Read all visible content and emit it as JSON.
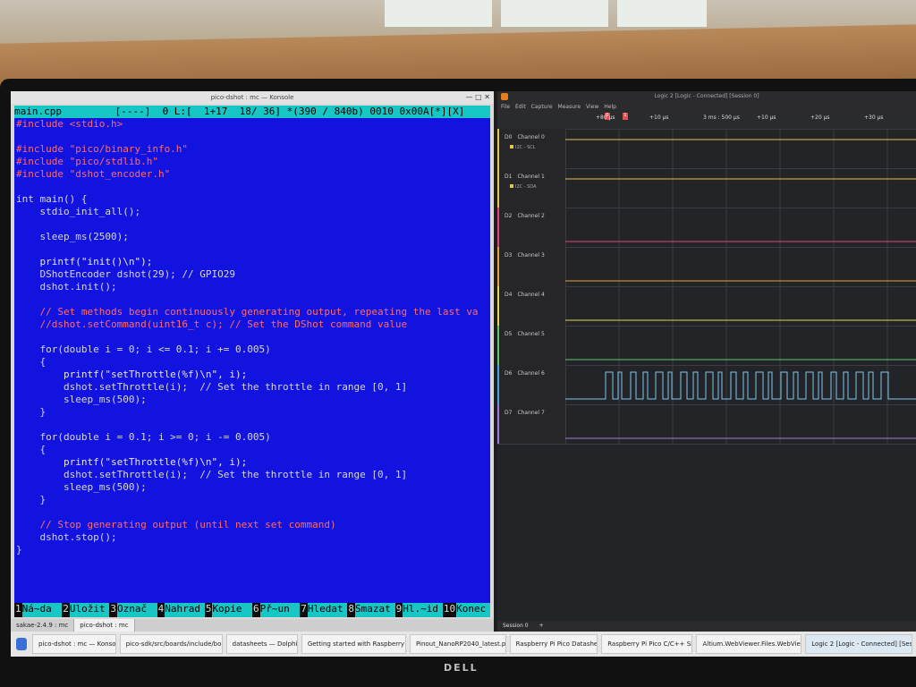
{
  "konsole": {
    "window_title": "pico-dshot : mc — Konsole",
    "status_line": "main.cpp         [----]  0 L:[  1+17  18/ 36] *(390 / 840b) 0010 0x00A[*][X]",
    "code_lines": [
      "#include <stdio.h>",
      "",
      "#include \"pico/binary_info.h\"",
      "#include \"pico/stdlib.h\"",
      "#include \"dshot_encoder.h\"",
      "",
      "int main() {",
      "    stdio_init_all();",
      "",
      "    sleep_ms(2500);",
      "",
      "    printf(\"init()\\n\");",
      "    DShotEncoder dshot(29); // GPIO29",
      "    dshot.init();",
      "",
      "    // Set methods begin continuously generating output, repeating the last va",
      "    //dshot.setCommand(uint16_t c); // Set the DShot command value",
      "",
      "    for(double i = 0; i <= 0.1; i += 0.005)",
      "    {",
      "        printf(\"setThrottle(%f)\\n\", i);",
      "        dshot.setThrottle(i);  // Set the throttle in range [0, 1]",
      "        sleep_ms(500);",
      "    }",
      "",
      "    for(double i = 0.1; i >= 0; i -= 0.005)",
      "    {",
      "        printf(\"setThrottle(%f)\\n\", i);",
      "        dshot.setThrottle(i);  // Set the throttle in range [0, 1]",
      "        sleep_ms(500);",
      "    }",
      "",
      "    // Stop generating output (until next set command)",
      "    dshot.stop();",
      "}"
    ],
    "fkeys": [
      {
        "num": "1",
        "label": "Ná~da"
      },
      {
        "num": "2",
        "label": "Uložit"
      },
      {
        "num": "3",
        "label": "Označ"
      },
      {
        "num": "4",
        "label": "Nahrad"
      },
      {
        "num": "5",
        "label": "Kopie"
      },
      {
        "num": "6",
        "label": "Př~un"
      },
      {
        "num": "7",
        "label": "Hledat"
      },
      {
        "num": "8",
        "label": "Smazat"
      },
      {
        "num": "9",
        "label": "Hl.~id"
      },
      {
        "num": "10",
        "label": "Konec"
      }
    ],
    "tabs": [
      "sakae-2.4.9 : mc",
      "pico-dshot : mc"
    ]
  },
  "logic": {
    "window_title": "Logic 2 [Logic - Connected] [Session 0]",
    "menu": [
      "File",
      "Edit",
      "Capture",
      "Measure",
      "View",
      "Help"
    ],
    "ruler_labels": [
      "+80 µs",
      "+10 µs",
      "3 ms : 500 µs",
      "+10 µs",
      "+20 µs",
      "+30 µs"
    ],
    "channels": [
      {
        "id": "D0",
        "name": "Channel 0",
        "sub": "I2C - SCL",
        "color": "#e6c44f"
      },
      {
        "id": "D1",
        "name": "Channel 1",
        "sub": "I2C - SDA",
        "color": "#e6c44f"
      },
      {
        "id": "D2",
        "name": "Channel 2",
        "sub": "",
        "color": "#e0457b"
      },
      {
        "id": "D3",
        "name": "Channel 3",
        "sub": "",
        "color": "#e8a23a"
      },
      {
        "id": "D4",
        "name": "Channel 4",
        "sub": "",
        "color": "#e6d84f"
      },
      {
        "id": "D5",
        "name": "Channel 5",
        "sub": "",
        "color": "#5cc96a"
      },
      {
        "id": "D6",
        "name": "Channel 6",
        "sub": "",
        "color": "#4aa3e0"
      },
      {
        "id": "D7",
        "name": "Channel 7",
        "sub": "",
        "color": "#a57be0"
      }
    ],
    "session_tab": "Session 0"
  },
  "taskbar": {
    "items": [
      "pico-dshot : mc — Konsole",
      "pico-sdk/src/boards/include/boa...",
      "datasheets — Dolphin",
      "Getting started with Raspberry P...",
      "Pinout_NanoRP2040_latest.png",
      "Raspberry Pi Pico Datasheet",
      "Raspberry Pi Pico C/C++ SDK",
      "Altium.WebViewer.Files.WebView...",
      "Logic 2 [Logic - Connected] [Sess..."
    ]
  },
  "monitor": {
    "brand": "DELL"
  }
}
